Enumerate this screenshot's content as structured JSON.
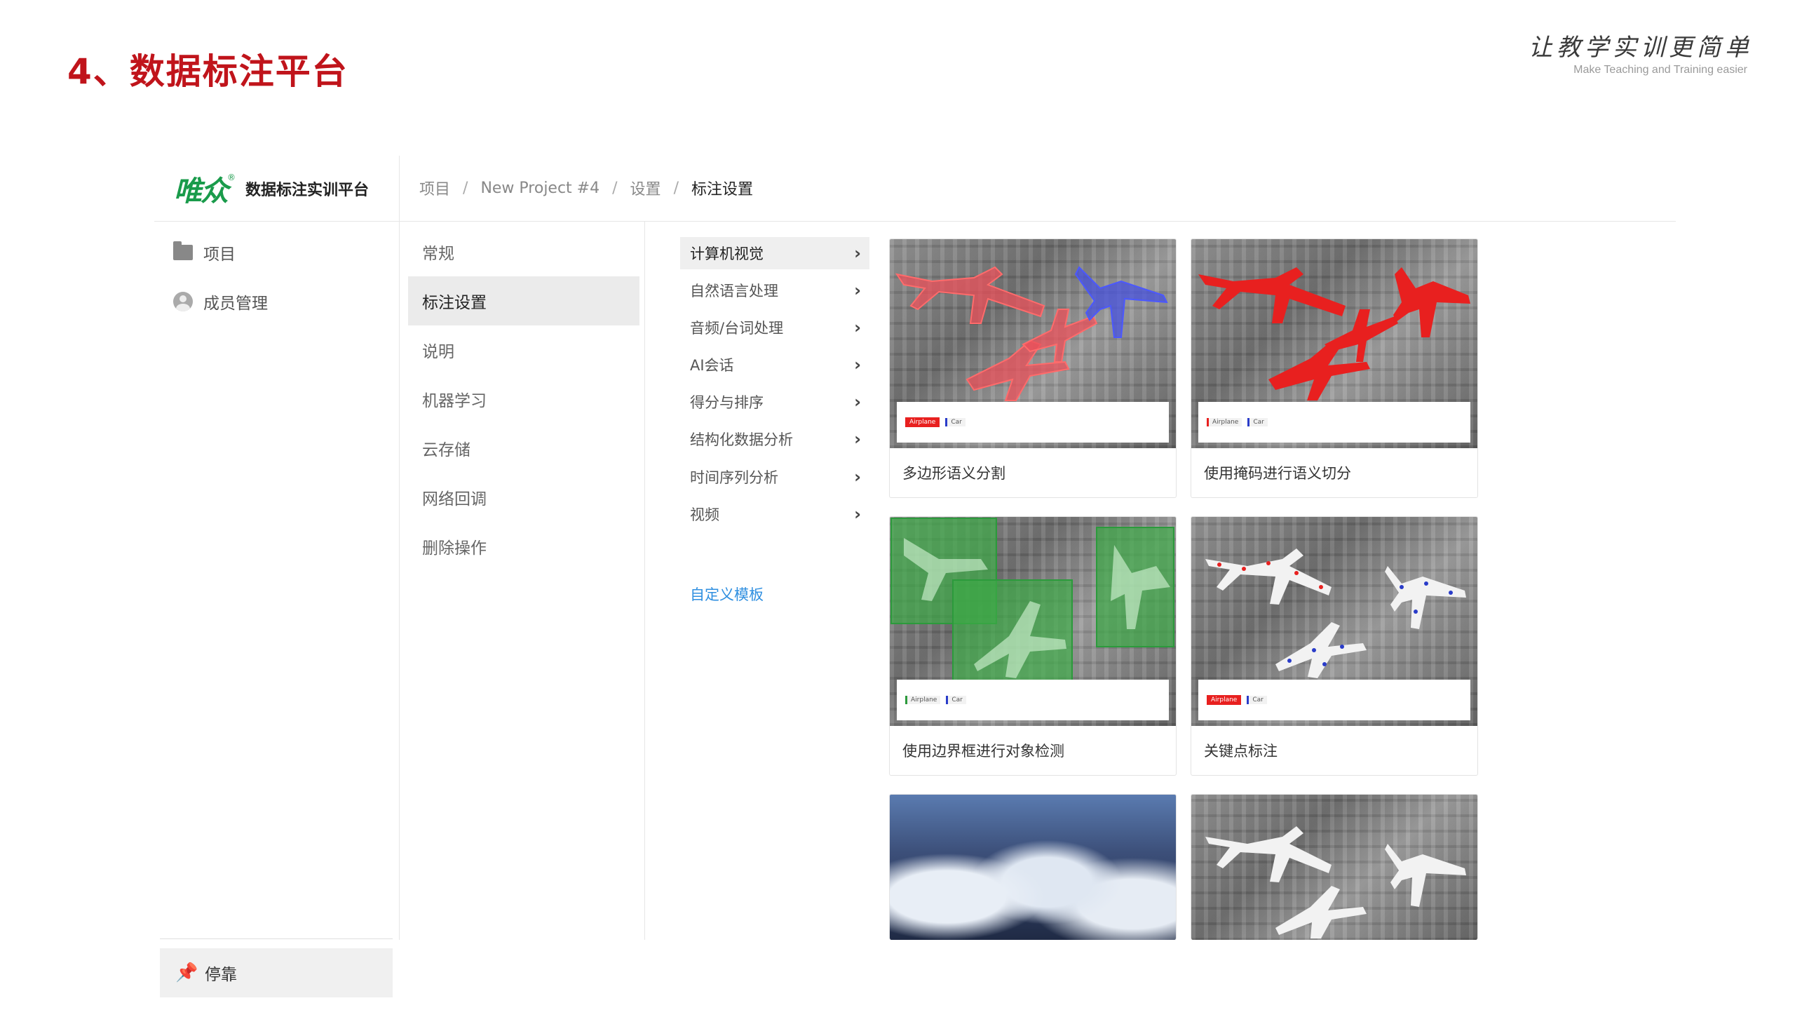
{
  "slide": {
    "title": "4、数据标注平台",
    "slogan_cn": "让教学实训更简单",
    "slogan_en": "Make Teaching and Training easier"
  },
  "app": {
    "logo_mark": "唯众",
    "logo_reg": "®",
    "logo_text": "数据标注实训平台"
  },
  "breadcrumb": {
    "items": [
      "项目",
      "New Project #4",
      "设置",
      "标注设置"
    ],
    "separator": "/"
  },
  "sidebar": {
    "items": [
      {
        "label": "项目",
        "icon": "folder-icon"
      },
      {
        "label": "成员管理",
        "icon": "user-icon"
      }
    ],
    "dock_label": "停靠",
    "dock_icon": "pin-icon"
  },
  "settings_menu": {
    "items": [
      "常规",
      "标注设置",
      "说明",
      "机器学习",
      "云存储",
      "网络回调",
      "删除操作"
    ],
    "active": "标注设置"
  },
  "categories": {
    "items": [
      "计算机视觉",
      "自然语言处理",
      "音频/台词处理",
      "AI会话",
      "得分与排序",
      "结构化数据分析",
      "时间序列分析",
      "视频"
    ],
    "active": "计算机视觉",
    "custom_link": "自定义模板"
  },
  "templates": {
    "cards": [
      {
        "title": "多边形语义分割",
        "tags": [
          "Airplane",
          "Car"
        ]
      },
      {
        "title": "使用掩码进行语义切分",
        "tags": [
          "Airplane",
          "Car"
        ]
      },
      {
        "title": "使用边界框进行对象检测",
        "tags": [
          "Airplane",
          "Car"
        ]
      },
      {
        "title": "关键点标注",
        "tags": [
          "Airplane",
          "Car"
        ]
      },
      {
        "title": "",
        "tags": []
      },
      {
        "title": "",
        "tags": []
      }
    ]
  },
  "colors": {
    "title_red": "#c0141b",
    "logo_green": "#1a9b4b",
    "link_blue": "#2f8fe0",
    "active_bg": "#ebebeb"
  }
}
